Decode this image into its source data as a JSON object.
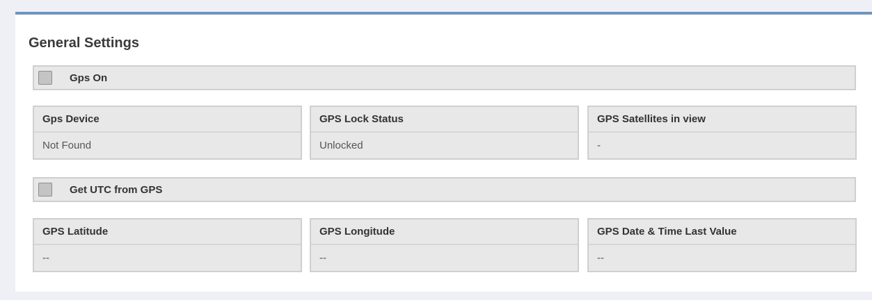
{
  "section": {
    "title": "General Settings"
  },
  "toggles": {
    "gps_on": {
      "label": "Gps On",
      "checked": false
    },
    "utc_from_gps": {
      "label": "Get UTC from GPS",
      "checked": false
    }
  },
  "status_row_1": [
    {
      "label": "Gps Device",
      "value": "Not Found"
    },
    {
      "label": "GPS Lock Status",
      "value": "Unlocked"
    },
    {
      "label": "GPS Satellites in view",
      "value": "-"
    }
  ],
  "status_row_2": [
    {
      "label": "GPS Latitude",
      "value": "--"
    },
    {
      "label": "GPS Longitude",
      "value": "--"
    },
    {
      "label": "GPS Date & Time Last Value",
      "value": "--"
    }
  ],
  "colors": {
    "page_background": "#eef0f5",
    "panel_accent": "#6e94c2",
    "card_background": "#e8e8e8",
    "checkbox_fill": "#c4c4c4"
  }
}
